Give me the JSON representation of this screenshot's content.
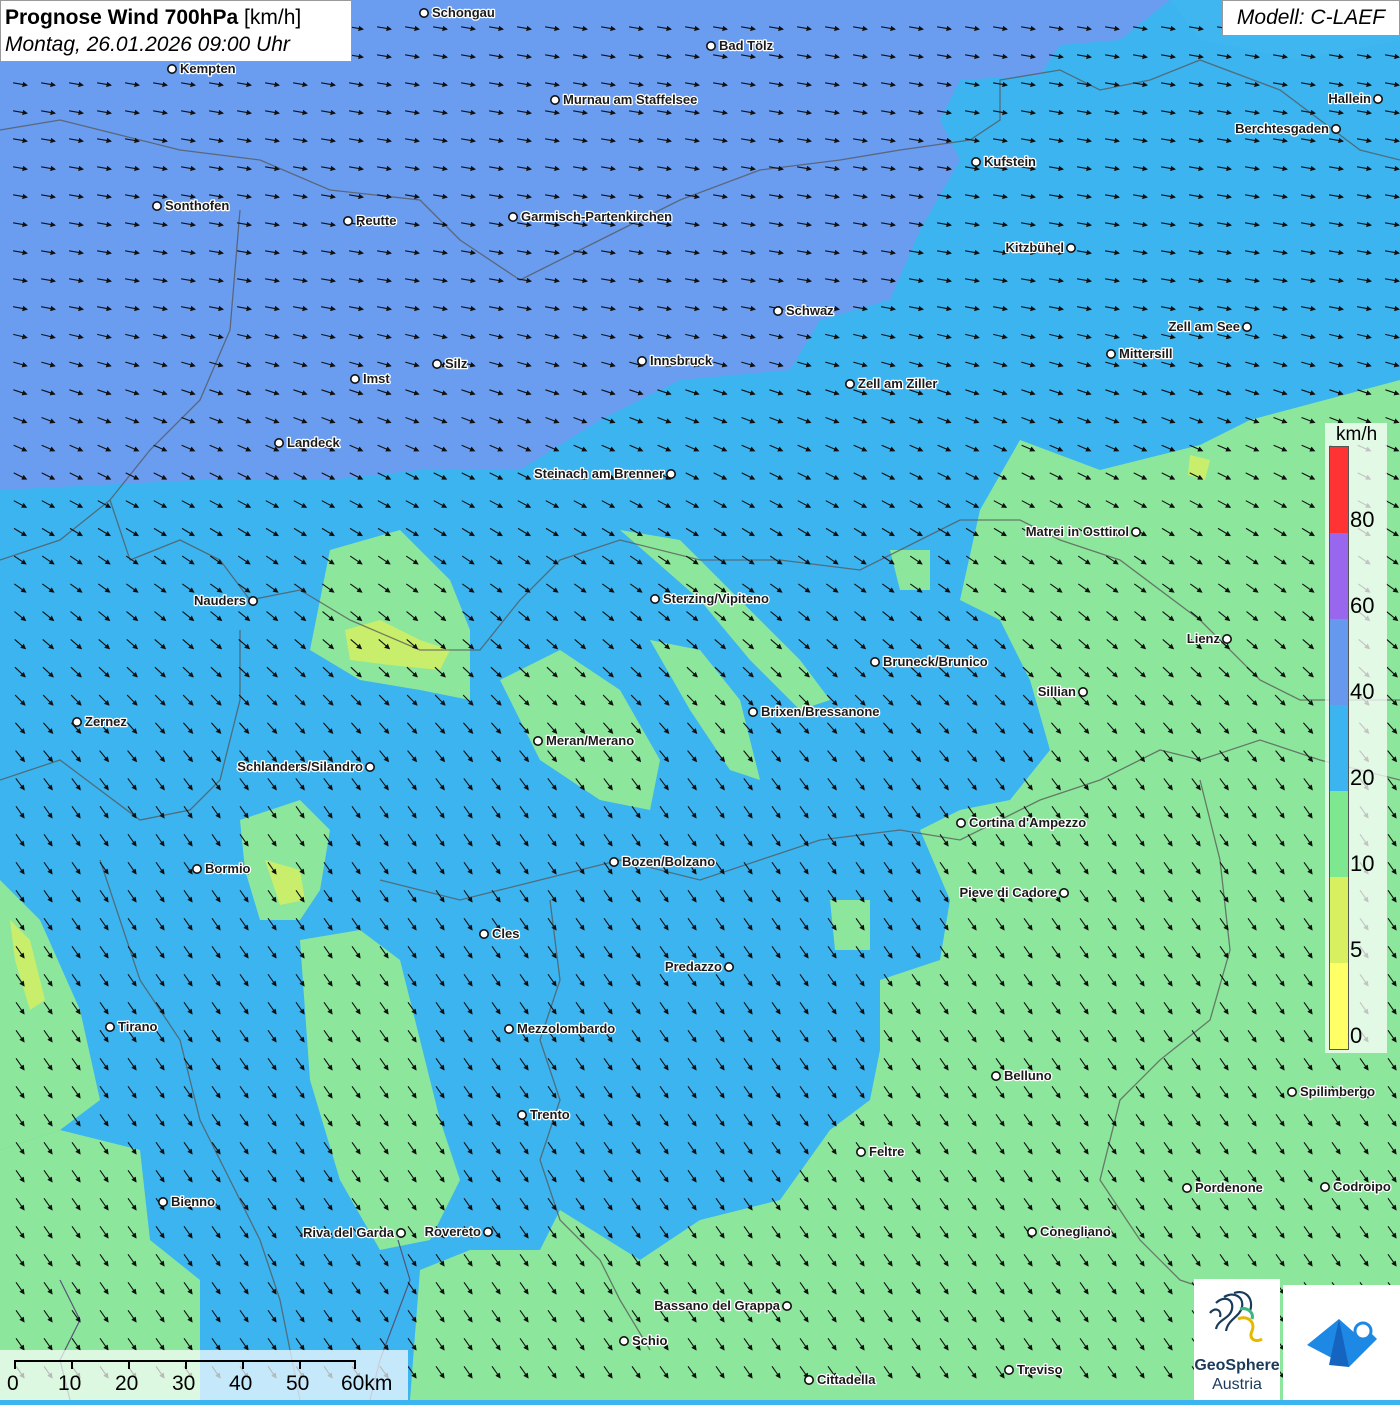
{
  "header": {
    "title_bold": "Prognose Wind 700hPa",
    "title_unit": "[km/h]",
    "date": "Montag, 26.01.2026 09:00 Uhr",
    "model": "Modell: C-LAEF"
  },
  "legend": {
    "unit": "km/h",
    "ticks": [
      "80",
      "60",
      "40",
      "20",
      "10",
      "5",
      "0"
    ],
    "colors": [
      "#ffff66",
      "#d8f060",
      "#7de890",
      "#3cb4f0",
      "#6699ee",
      "#9966ee",
      "#ff3333"
    ]
  },
  "scalebar": {
    "labels": [
      "0",
      "10",
      "20",
      "30",
      "40",
      "50",
      "60km"
    ]
  },
  "logos": {
    "geosphere_line1": "GeoSphere",
    "geosphere_line2": "Austria"
  },
  "cities": [
    {
      "name": "Schongau"
    },
    {
      "name": "Bad Tölz"
    },
    {
      "name": "Kempten"
    },
    {
      "name": "Murnau am Staffelsee"
    },
    {
      "name": "Hallein"
    },
    {
      "name": "Berchtesgaden"
    },
    {
      "name": "Kufstein"
    },
    {
      "name": "Sonthofen"
    },
    {
      "name": "Reutte"
    },
    {
      "name": "Garmisch-Partenkirchen"
    },
    {
      "name": "Kitzbühel"
    },
    {
      "name": "Schwaz"
    },
    {
      "name": "Zell am See"
    },
    {
      "name": "Mittersill"
    },
    {
      "name": "Innsbruck"
    },
    {
      "name": "Silz"
    },
    {
      "name": "Imst"
    },
    {
      "name": "Zell am Ziller"
    },
    {
      "name": "Landeck"
    },
    {
      "name": "Steinach am Brenner"
    },
    {
      "name": "Matrei in Osttirol"
    },
    {
      "name": "Nauders"
    },
    {
      "name": "Sterzing/Vipiteno"
    },
    {
      "name": "Lienz"
    },
    {
      "name": "Bruneck/Brunico"
    },
    {
      "name": "Sillian"
    },
    {
      "name": "Brixen/Bressanone"
    },
    {
      "name": "Zernez"
    },
    {
      "name": "Meran/Merano"
    },
    {
      "name": "Schlanders/Silandro"
    },
    {
      "name": "Cortina d'Ampezzo"
    },
    {
      "name": "Bozen/Bolzano"
    },
    {
      "name": "Bormio"
    },
    {
      "name": "Pieve di Cadore"
    },
    {
      "name": "Cles"
    },
    {
      "name": "Predazzo"
    },
    {
      "name": "Tirano"
    },
    {
      "name": "Mezzolombardo"
    },
    {
      "name": "Belluno"
    },
    {
      "name": "Spilimbergo"
    },
    {
      "name": "Trento"
    },
    {
      "name": "Feltre"
    },
    {
      "name": "Pordenone"
    },
    {
      "name": "Codroipo"
    },
    {
      "name": "Bienno"
    },
    {
      "name": "Riva del Garda"
    },
    {
      "name": "Rovereto"
    },
    {
      "name": "Conegliano"
    },
    {
      "name": "Bassano del Grappa"
    },
    {
      "name": "Schio"
    },
    {
      "name": "Treviso"
    },
    {
      "name": "Cittadella"
    }
  ]
}
